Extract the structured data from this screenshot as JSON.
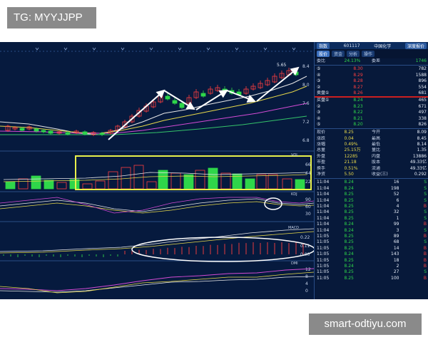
{
  "watermarks": {
    "top_left": "TG: MYYJJPP",
    "bottom_right": "smart-odtiyu.com"
  },
  "chart": {
    "top_right_label": "5.65",
    "price_axis": [
      "8.4",
      "8.0",
      "7.6",
      "7.2",
      "6.8"
    ],
    "volume_axis": [
      "66",
      "44",
      "22"
    ],
    "ind1_axis": [
      "90",
      "60",
      "30"
    ],
    "ind2_axis": [
      "0.22",
      "0.11",
      "0.00"
    ],
    "ind3_axis": [
      "12",
      "8",
      "4",
      "0"
    ],
    "panel_labels": [
      "VOL",
      "KDJ",
      "MACD",
      "DMI"
    ]
  },
  "panel": {
    "header_code": "601117",
    "header_name": "中国化学",
    "header_btn_left": "指数",
    "header_btn_right": "深度报价",
    "tabs": [
      "股价",
      "资金",
      "分析",
      "操作"
    ],
    "ratio_row": {
      "label": "委比",
      "value": "24.13%",
      "diff_label": "委差",
      "diff": "1746"
    },
    "sell_rows": [
      {
        "label": "⑤",
        "price": "8.30",
        "vol": "782"
      },
      {
        "label": "④",
        "price": "8.29",
        "vol": "1588"
      },
      {
        "label": "③",
        "price": "8.28",
        "vol": "896"
      },
      {
        "label": "②",
        "price": "8.27",
        "vol": "554"
      },
      {
        "label": "卖盘①",
        "price": "8.26",
        "vol": "681"
      }
    ],
    "buy_rows": [
      {
        "label": "买盘①",
        "price": "8.24",
        "vol": "465"
      },
      {
        "label": "②",
        "price": "8.23",
        "vol": "671"
      },
      {
        "label": "③",
        "price": "8.22",
        "vol": "497"
      },
      {
        "label": "④",
        "price": "8.21",
        "vol": "338"
      },
      {
        "label": "⑤",
        "price": "8.20",
        "vol": "826"
      }
    ],
    "stats": [
      {
        "k1": "现价",
        "v1": "8.25",
        "k2": "今开",
        "v2": "8.09"
      },
      {
        "k1": "涨跌",
        "v1": "0.04",
        "k2": "最高",
        "v2": "8.45"
      },
      {
        "k1": "涨幅",
        "v1": "0.49%",
        "k2": "最低",
        "v2": "8.14"
      },
      {
        "k1": "总量",
        "v1": "25.15万",
        "k2": "量比",
        "v2": "1.35"
      },
      {
        "k1": "外盘",
        "v1": "12285",
        "k2": "内盘",
        "v2": "13886"
      },
      {
        "k1": "市盈",
        "v1": "21.18",
        "k2": "股本",
        "v2": "49.33亿"
      },
      {
        "k1": "换手",
        "v1": "0.51%",
        "k2": "流通",
        "v2": "49.33亿"
      },
      {
        "k1": "净资",
        "v1": "5.50",
        "k2": "收益(三)",
        "v2": "0.292"
      }
    ],
    "trades": [
      {
        "t": "11:04",
        "p": "8.24",
        "v": "16",
        "f": "S"
      },
      {
        "t": "11:04",
        "p": "8.24",
        "v": "198",
        "f": "S"
      },
      {
        "t": "11:04",
        "p": "8.25",
        "v": "52",
        "f": "S"
      },
      {
        "t": "11:04",
        "p": "8.25",
        "v": "6",
        "f": "S"
      },
      {
        "t": "11:04",
        "p": "8.25",
        "v": "4",
        "f": "B"
      },
      {
        "t": "11:04",
        "p": "8.25",
        "v": "32",
        "f": "S"
      },
      {
        "t": "11:04",
        "p": "8.25",
        "v": "1",
        "f": "S"
      },
      {
        "t": "11:04",
        "p": "8.24",
        "v": "99",
        "f": "B"
      },
      {
        "t": "11:04",
        "p": "8.24",
        "v": "3",
        "f": "S"
      },
      {
        "t": "11:05",
        "p": "8.25",
        "v": "89",
        "f": "B"
      },
      {
        "t": "11:05",
        "p": "8.25",
        "v": "68",
        "f": "S"
      },
      {
        "t": "11:05",
        "p": "8.25",
        "v": "14",
        "f": "B"
      },
      {
        "t": "11:05",
        "p": "8.24",
        "v": "143",
        "f": "B"
      },
      {
        "t": "11:05",
        "p": "8.25",
        "v": "18",
        "f": "B"
      },
      {
        "t": "11:05",
        "p": "8.24",
        "v": "2",
        "f": "B"
      },
      {
        "t": "11:05",
        "p": "8.25",
        "v": "27",
        "f": "S"
      },
      {
        "t": "11:05",
        "p": "8.25",
        "v": "100",
        "f": "B"
      }
    ]
  },
  "colors": {
    "bg": "#061a3e",
    "up": "#ff3f3f",
    "down": "#2fd64a",
    "highlight_box": "#e8f04a",
    "annotation": "#ffffff"
  }
}
